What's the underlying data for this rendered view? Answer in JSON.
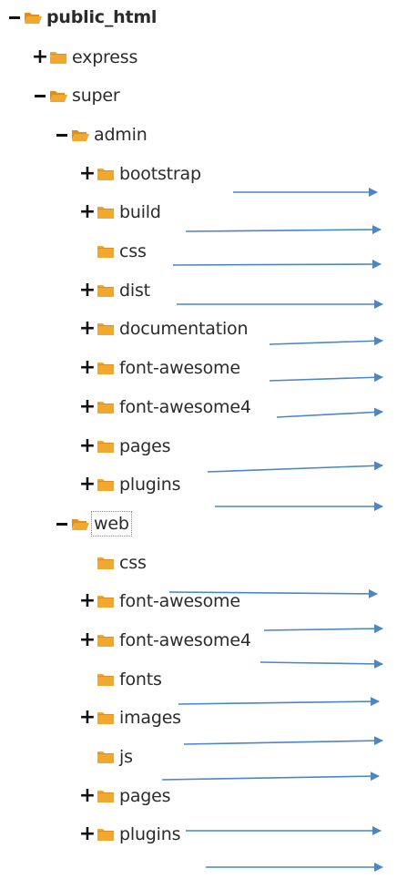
{
  "tree": {
    "rows": [
      {
        "label": "public_html",
        "toggle": "minus",
        "open": true,
        "bold": true
      },
      {
        "label": "express",
        "toggle": "plus",
        "open": false
      },
      {
        "label": "super",
        "toggle": "minus",
        "open": true
      },
      {
        "label": "admin",
        "toggle": "minus",
        "open": true
      },
      {
        "label": "bootstrap",
        "toggle": "plus",
        "open": false
      },
      {
        "label": "build",
        "toggle": "plus",
        "open": false
      },
      {
        "label": "css",
        "toggle": "none",
        "open": false
      },
      {
        "label": "dist",
        "toggle": "plus",
        "open": false
      },
      {
        "label": "documentation",
        "toggle": "plus",
        "open": false
      },
      {
        "label": "font-awesome",
        "toggle": "plus",
        "open": false
      },
      {
        "label": "font-awesome4",
        "toggle": "plus",
        "open": false
      },
      {
        "label": "pages",
        "toggle": "plus",
        "open": false
      },
      {
        "label": "plugins",
        "toggle": "plus",
        "open": false
      },
      {
        "label": "web",
        "toggle": "minus",
        "open": true,
        "selected": true
      },
      {
        "label": "css",
        "toggle": "none",
        "open": false
      },
      {
        "label": "font-awesome",
        "toggle": "plus",
        "open": false
      },
      {
        "label": "font-awesome4",
        "toggle": "plus",
        "open": false
      },
      {
        "label": "fonts",
        "toggle": "none",
        "open": false
      },
      {
        "label": "images",
        "toggle": "plus",
        "open": false
      },
      {
        "label": "js",
        "toggle": "none",
        "open": false
      },
      {
        "label": "pages",
        "toggle": "plus",
        "open": false
      },
      {
        "label": "plugins",
        "toggle": "plus",
        "open": false
      }
    ]
  },
  "colors": {
    "folder": "#f0a830",
    "folder_dark": "#e0901a",
    "arrow": "#4a86c8"
  },
  "icons": {
    "collapse": "minus-icon",
    "expand": "plus-icon",
    "folder_closed": "folder-icon",
    "folder_open": "folder-open-icon",
    "annotation": "arrow-icon"
  }
}
